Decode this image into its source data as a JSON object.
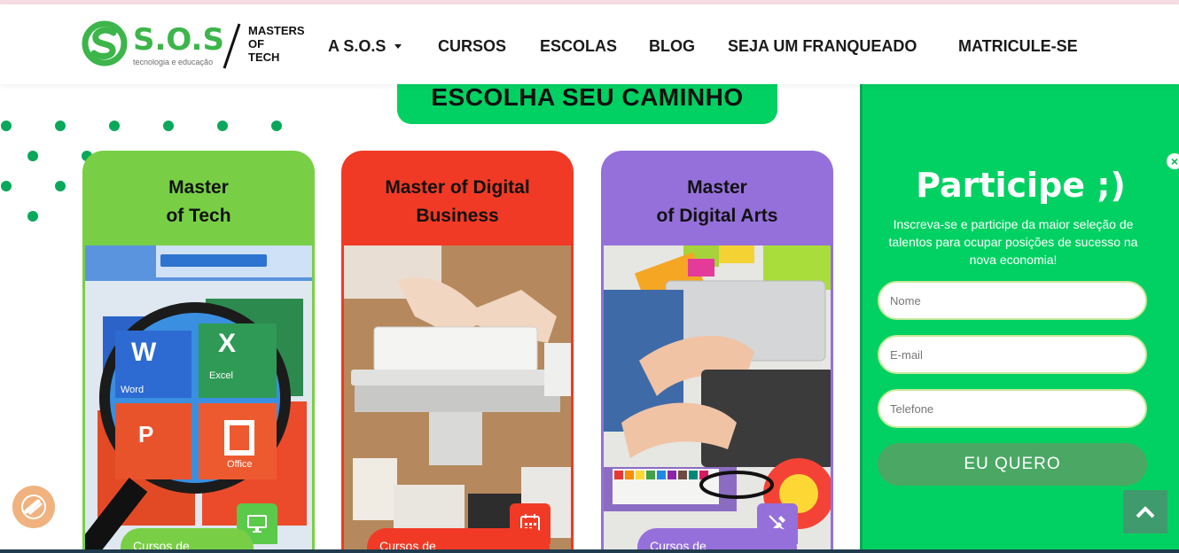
{
  "header": {
    "logo": {
      "brand": "S.O.S",
      "tagline": "tecnologia e educação",
      "masters_line1": "MASTERS",
      "masters_line2": "OF",
      "masters_line3": "TECH"
    },
    "nav": [
      {
        "label": "A S.O.S",
        "has_dropdown": true
      },
      {
        "label": "CURSOS"
      },
      {
        "label": "ESCOLAS"
      },
      {
        "label": "BLOG"
      },
      {
        "label": "SEJA UM FRANQUEADO"
      },
      {
        "label": "MATRICULE-SE"
      }
    ]
  },
  "banner": {
    "title": "ESCOLHA SEU CAMINHO"
  },
  "cards": [
    {
      "title_line1": "Master",
      "title_line2": "of Tech",
      "pill": "Cursos de",
      "color": "#78cf45",
      "badge_icon": "monitor-icon"
    },
    {
      "title_line1": "Master of Digital",
      "title_line2": "Business",
      "pill": "Cursos de",
      "color": "#f13a25",
      "badge_icon": "calendar-icon"
    },
    {
      "title_line1": "Master",
      "title_line2": "of Digital Arts",
      "pill": "Cursos de",
      "color": "#9570da",
      "badge_icon": "pen-ruler-icon"
    }
  ],
  "signup": {
    "title": "Participe ;)",
    "description": "Inscreva-se e participe da maior seleção de talentos para ocupar posições de sucesso na nova economia!",
    "name_placeholder": "Nome",
    "email_placeholder": "E-mail",
    "phone_placeholder": "Telefone",
    "submit_label": "EU QUERO",
    "accent": "#00d162"
  },
  "colors": {
    "brand_green": "#3cb54a",
    "accent": "#00d162",
    "dots": "#0aa85a"
  }
}
